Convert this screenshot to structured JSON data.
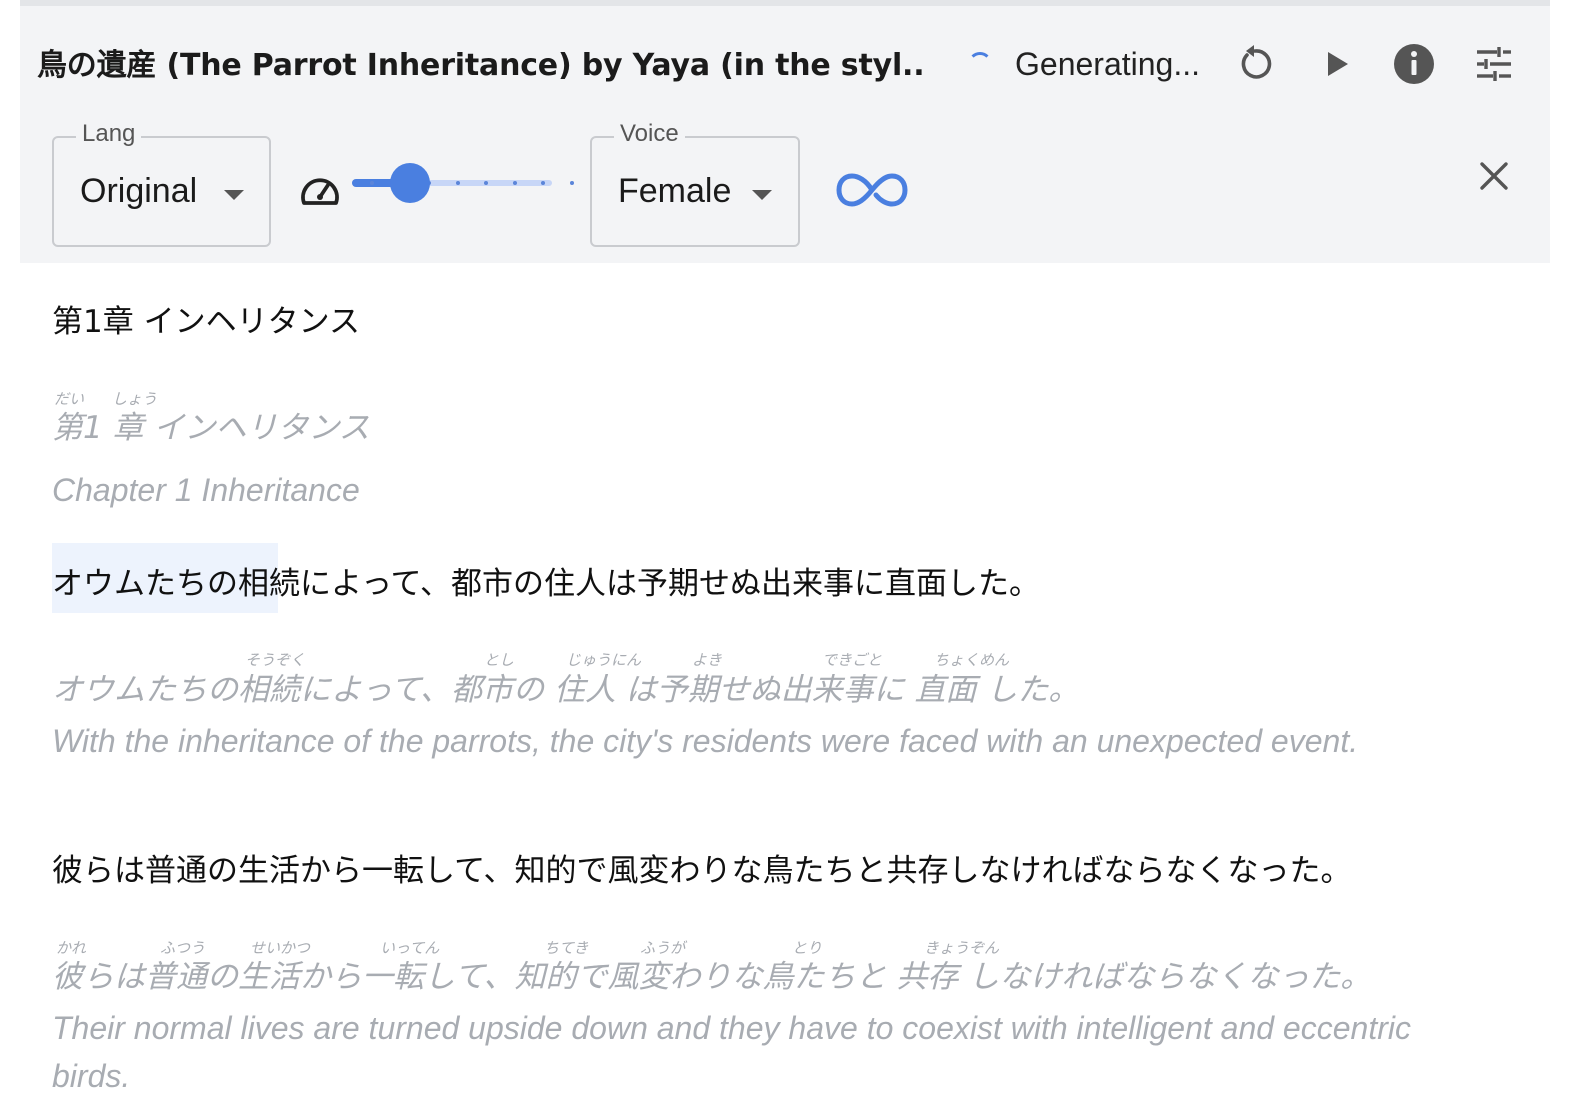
{
  "header": {
    "title": "鳥の遺産 (The Parrot Inheritance) by Yaya (in the styl...",
    "status": "Generating...",
    "lang": {
      "legend": "Lang",
      "value": "Original"
    },
    "voice": {
      "legend": "Voice",
      "value": "Female"
    },
    "speed": {
      "fraction": 0.29,
      "steps": 8
    },
    "icons": [
      "restart-icon",
      "play-icon",
      "info-icon",
      "settings-sliders-icon",
      "gauge-icon",
      "loop-icon",
      "close-icon"
    ],
    "accent_color": "#4a7fe0"
  },
  "content": {
    "chapter_heading": "第1章 インヘリタンス",
    "blocks": [
      {
        "furigana_line": "第1 章 インヘリタンス",
        "ruby": [
          "だい",
          "しょう"
        ],
        "translation": "Chapter 1 Inheritance"
      },
      {
        "sentence": "オウムたちの相続によって、都市の住人は予期せぬ出来事に直面した。",
        "highlighted_text": "オウムたちの相続",
        "furigana_line": "オウムたちの相続によって、都市の 住人 は予期せぬ出来事に 直面 した。",
        "ruby": [
          "そうぞく",
          "とし",
          "じゅうにん",
          "よき",
          "できごと",
          "ちょくめん"
        ],
        "translation": "With the inheritance of the parrots, the city's residents were faced with an unexpected event."
      },
      {
        "sentence": "彼らは普通の生活から一転して、知的で風変わりな鳥たちと共存しなければならなくなった。",
        "furigana_line": "彼らは普通の生活から一転して、知的で風変わりな鳥たちと 共存 しなければならなくなった。",
        "ruby": [
          "かれ",
          "ふつう",
          "せいかつ",
          "いってん",
          "ちてき",
          "ふうが",
          "とり",
          "きょうぞん"
        ],
        "translation": "Their normal lives are turned upside down and they have to coexist with intelligent and eccentric birds."
      }
    ]
  }
}
